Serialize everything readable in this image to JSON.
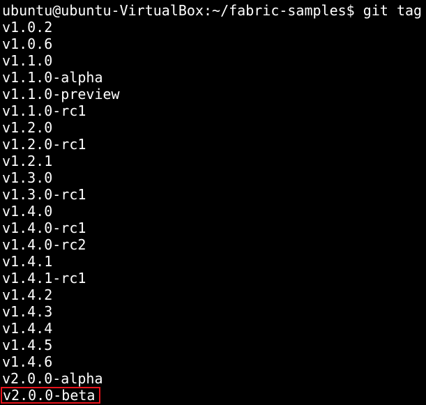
{
  "terminal": {
    "background_color": "#000000",
    "text_color": "#ffffff",
    "highlight_color": "#e8141c",
    "prompt": "ubuntu@ubuntu-VirtualBox:~/fabric-samples$",
    "command": "git tag",
    "tags": [
      "v1.0.2",
      "v1.0.6",
      "v1.1.0",
      "v1.1.0-alpha",
      "v1.1.0-preview",
      "v1.1.0-rc1",
      "v1.2.0",
      "v1.2.0-rc1",
      "v1.2.1",
      "v1.3.0",
      "v1.3.0-rc1",
      "v1.4.0",
      "v1.4.0-rc1",
      "v1.4.0-rc2",
      "v1.4.1",
      "v1.4.1-rc1",
      "v1.4.2",
      "v1.4.3",
      "v1.4.4",
      "v1.4.5",
      "v1.4.6",
      "v2.0.0-alpha"
    ],
    "highlighted_tag": "v2.0.0-beta"
  }
}
